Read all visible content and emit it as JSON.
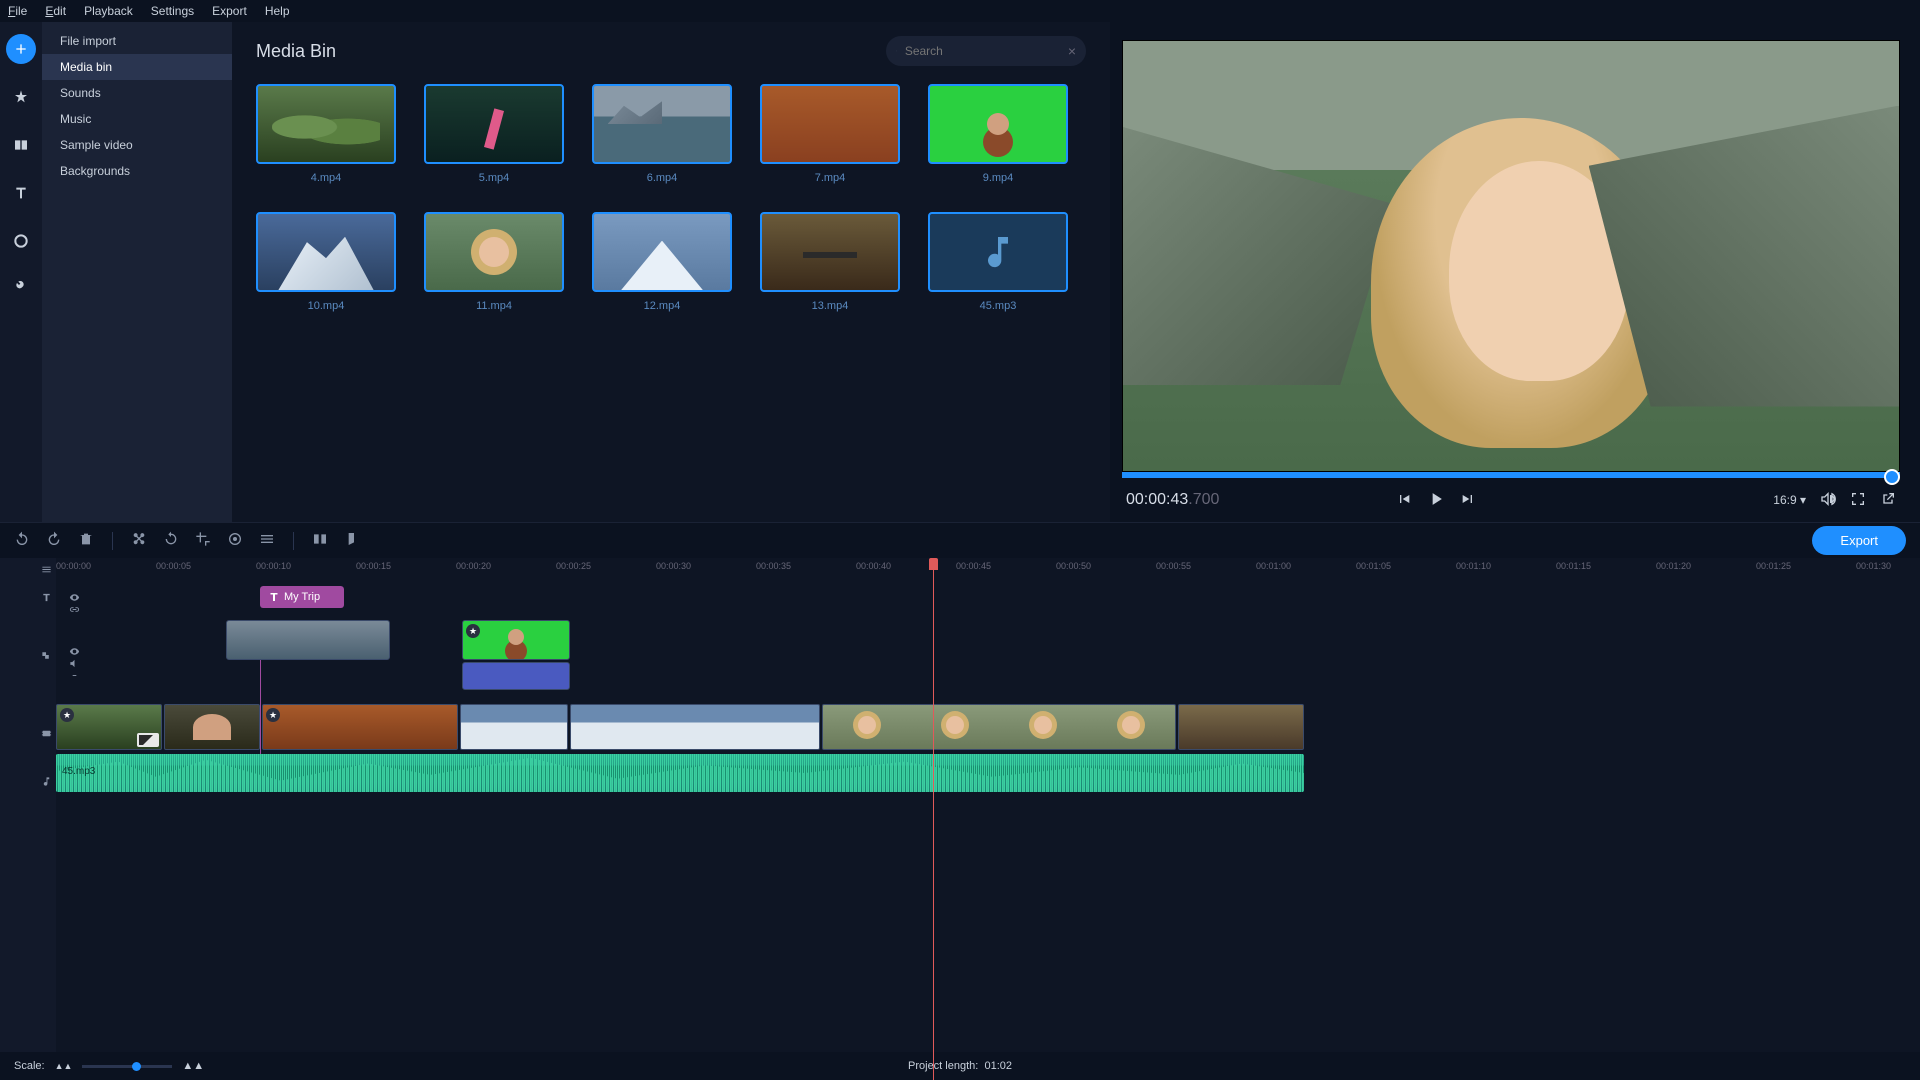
{
  "menu": {
    "file": "File",
    "edit": "Edit",
    "playback": "Playback",
    "settings": "Settings",
    "export": "Export",
    "help": "Help"
  },
  "sidebar": {
    "cats": [
      {
        "label": "File import"
      },
      {
        "label": "Media bin"
      },
      {
        "label": "Sounds"
      },
      {
        "label": "Music"
      },
      {
        "label": "Sample video"
      },
      {
        "label": "Backgrounds"
      }
    ]
  },
  "bin": {
    "title": "Media Bin"
  },
  "search": {
    "placeholder": "Search"
  },
  "thumbs": [
    {
      "label": "4.mp4"
    },
    {
      "label": "5.mp4"
    },
    {
      "label": "6.mp4"
    },
    {
      "label": "7.mp4"
    },
    {
      "label": "9.mp4"
    },
    {
      "label": "10.mp4"
    },
    {
      "label": "11.mp4"
    },
    {
      "label": "12.mp4"
    },
    {
      "label": "13.mp4"
    },
    {
      "label": "45.mp3"
    }
  ],
  "preview": {
    "time_main": "00:00:43",
    "time_frac": ".700",
    "aspect": "16:9"
  },
  "export_btn": "Export",
  "ruler": [
    "00:00:00",
    "00:00:05",
    "00:00:10",
    "00:00:15",
    "00:00:20",
    "00:00:25",
    "00:00:30",
    "00:00:35",
    "00:00:40",
    "00:00:45",
    "00:00:50",
    "00:00:55",
    "00:01:00",
    "00:01:05",
    "00:01:10",
    "00:01:15",
    "00:01:20",
    "00:01:25",
    "00:01:30"
  ],
  "title_clip": "My Trip",
  "audio_clip_label": "45.mp3",
  "footer": {
    "scale": "Scale:",
    "proj_label": "Project length:",
    "proj_val": "01:02"
  }
}
